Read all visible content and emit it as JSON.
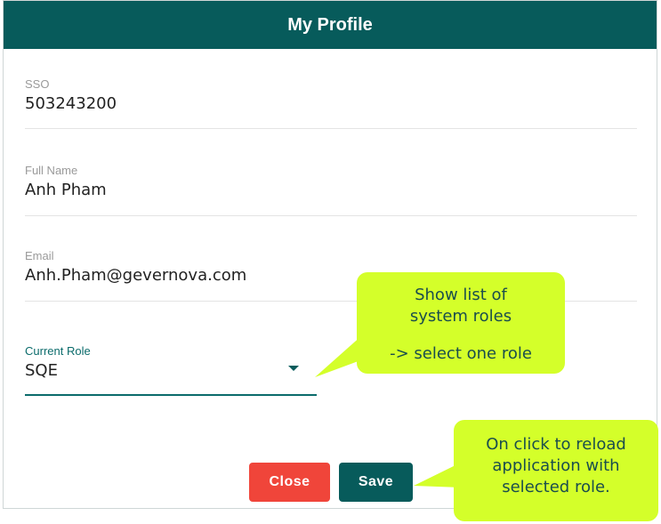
{
  "dialog": {
    "title": "My Profile"
  },
  "fields": {
    "sso": {
      "label": "SSO",
      "value": "503243200"
    },
    "full_name": {
      "label": "Full Name",
      "value": "Anh Pham"
    },
    "email": {
      "label": "Email",
      "value": "Anh.Pham@gevernova.com"
    },
    "current_role": {
      "label": "Current Role",
      "value": "SQE"
    }
  },
  "buttons": {
    "close_label": "Close",
    "save_label": "Save"
  },
  "annotations": {
    "role_callout": {
      "line1": "Show list of system roles",
      "line2": "-> select one role"
    },
    "save_callout": {
      "text": "On click to reload application with selected role."
    }
  },
  "colors": {
    "header": "#075b5b",
    "close_button": "#f0453a",
    "save_button": "#075b5b",
    "callout": "#d4ff2a",
    "accent": "#0b6b6b"
  }
}
